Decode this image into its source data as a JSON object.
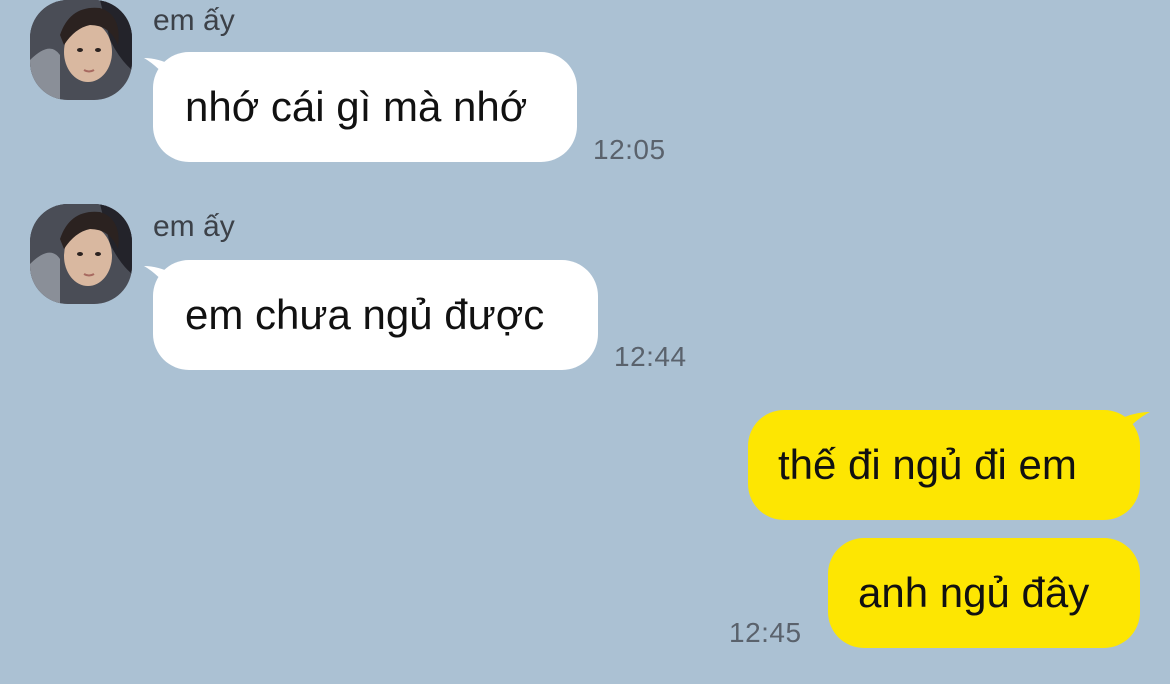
{
  "conversation": {
    "incoming": [
      {
        "sender": "em ấy",
        "avatar": "contact-photo",
        "text": "nhớ cái gì mà nhớ",
        "time": "12:05"
      },
      {
        "sender": "em ấy",
        "avatar": "contact-photo",
        "text": "em chưa ngủ được",
        "time": "12:44"
      }
    ],
    "outgoing": [
      {
        "text": "thế đi ngủ đi em"
      },
      {
        "text": "anh ngủ đây",
        "time": "12:45"
      }
    ]
  },
  "colors": {
    "background": "#abc1d3",
    "incoming_bubble": "#ffffff",
    "outgoing_bubble": "#fde602",
    "timestamp": "#5a626c"
  }
}
